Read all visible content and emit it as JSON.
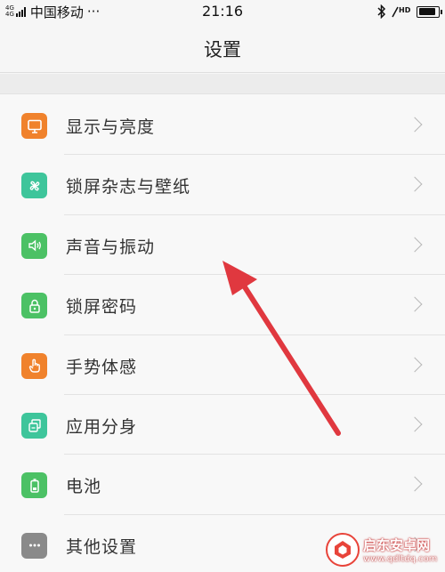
{
  "status_bar": {
    "network_type_top": "4G",
    "network_type_bottom": "4G",
    "carrier": "中国移动",
    "more": "···",
    "time": "21:16",
    "battery_level": 0.9,
    "icons": [
      "bluetooth-icon",
      "hd-icon",
      "battery-icon"
    ]
  },
  "header": {
    "title": "设置"
  },
  "settings": {
    "items": [
      {
        "label": "显示与亮度",
        "icon": "display-icon",
        "color": "#f0822c"
      },
      {
        "label": "锁屏杂志与壁纸",
        "icon": "pinwheel-icon",
        "color": "#3ec59b"
      },
      {
        "label": "声音与振动",
        "icon": "speaker-icon",
        "color": "#4cc165"
      },
      {
        "label": "锁屏密码",
        "icon": "lock-icon",
        "color": "#4cc165"
      },
      {
        "label": "手势体感",
        "icon": "hand-gesture-icon",
        "color": "#f0822c"
      },
      {
        "label": "应用分身",
        "icon": "app-clone-icon",
        "color": "#3ec59b"
      },
      {
        "label": "电池",
        "icon": "battery-icon",
        "color": "#4cc165"
      },
      {
        "label": "其他设置",
        "icon": "more-icon",
        "color": "#8a8a8a"
      }
    ]
  },
  "annotation": {
    "arrow_color": "#e0383f"
  },
  "watermark": {
    "title": "启东安卓网",
    "url": "www.qdltdq.com"
  }
}
